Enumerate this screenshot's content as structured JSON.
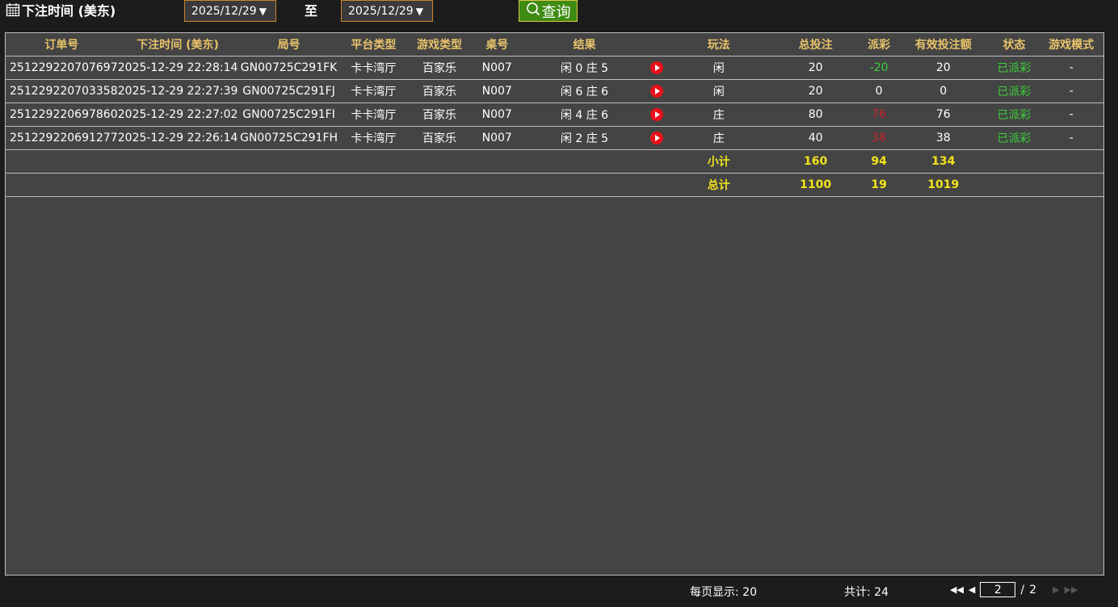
{
  "header": {
    "title": "下注时间 (美东)",
    "date_from": "2025/12/29",
    "to_label": "至",
    "date_to": "2025/12/29",
    "query_label": "查询"
  },
  "table": {
    "columns": [
      "订单号",
      "下注时间 (美东)",
      "局号",
      "平台类型",
      "游戏类型",
      "桌号",
      "结果",
      "",
      "玩法",
      "总投注",
      "派彩",
      "有效投注额",
      "状态",
      "游戏模式"
    ],
    "rows": [
      {
        "order": "251229220707697",
        "time": "2025-12-29 22:28:14",
        "round": "GN00725C291FK",
        "platform": "卡卡湾厅",
        "game": "百家乐",
        "table": "N007",
        "result": "闲 0 庄 5",
        "play": "闲",
        "bet": "20",
        "payout": "-20",
        "payout_color": "green",
        "valid": "20",
        "status": "已派彩",
        "mode": "-"
      },
      {
        "order": "251229220703358",
        "time": "2025-12-29 22:27:39",
        "round": "GN00725C291FJ",
        "platform": "卡卡湾厅",
        "game": "百家乐",
        "table": "N007",
        "result": "闲 6 庄 6",
        "play": "闲",
        "bet": "20",
        "payout": "0",
        "payout_color": "white",
        "valid": "0",
        "status": "已派彩",
        "mode": "-"
      },
      {
        "order": "251229220697860",
        "time": "2025-12-29 22:27:02",
        "round": "GN00725C291FI",
        "platform": "卡卡湾厅",
        "game": "百家乐",
        "table": "N007",
        "result": "闲 4 庄 6",
        "play": "庄",
        "bet": "80",
        "payout": "76",
        "payout_color": "red",
        "valid": "76",
        "status": "已派彩",
        "mode": "-"
      },
      {
        "order": "251229220691277",
        "time": "2025-12-29 22:26:14",
        "round": "GN00725C291FH",
        "platform": "卡卡湾厅",
        "game": "百家乐",
        "table": "N007",
        "result": "闲 2 庄 5",
        "play": "庄",
        "bet": "40",
        "payout": "38",
        "payout_color": "red",
        "valid": "38",
        "status": "已派彩",
        "mode": "-"
      }
    ],
    "subtotal": {
      "label": "小计",
      "bet": "160",
      "payout": "94",
      "valid": "134"
    },
    "grandtotal": {
      "label": "总计",
      "bet": "1100",
      "payout": "19",
      "valid": "1019"
    }
  },
  "footer": {
    "per_page": "每页显示: 20",
    "total": "共计: 24",
    "current_page": "2",
    "page_sep": "/",
    "page_count": "2"
  },
  "colors": {
    "header_text": "#e8c36a",
    "sum_text": "#f2e21c",
    "payout_green": "#3bd13b",
    "payout_red": "#c8242c",
    "status_green": "#3bd13b",
    "query_button": "#3e8c13"
  },
  "icons": {
    "title": "calendar-icon",
    "query": "search-icon",
    "replay": "play-icon"
  }
}
